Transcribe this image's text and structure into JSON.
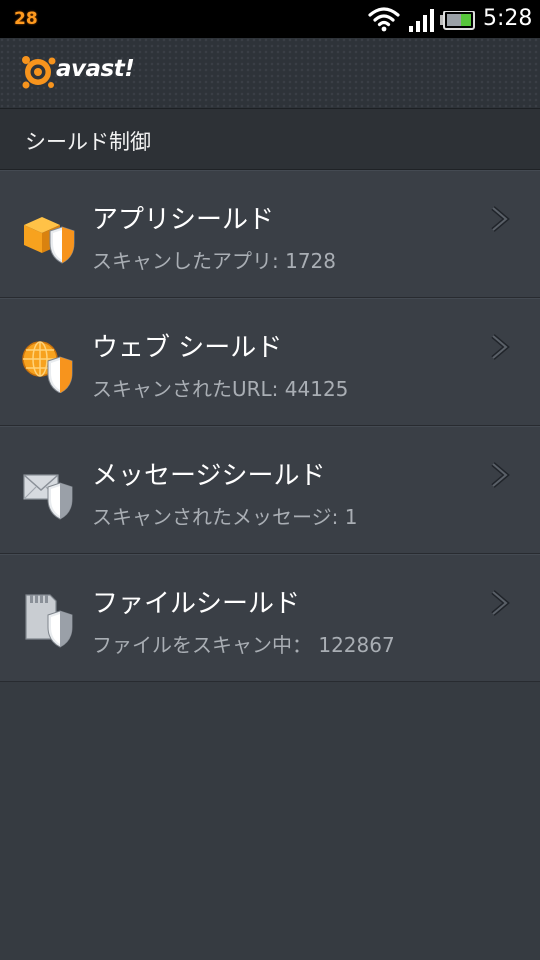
{
  "status_bar": {
    "notification_count": "28",
    "time": "5:28",
    "icons": [
      "wifi-icon",
      "signal-icon",
      "battery-icon"
    ]
  },
  "app_header": {
    "logo_text": "avast!",
    "logo_icon": "avast-logo-icon",
    "brand_color": "#f7941d"
  },
  "section": {
    "title": "シールド制御"
  },
  "shields": [
    {
      "title": "アプリシールド",
      "subtitle": "スキャンしたアプリ: 1728",
      "icon": "app-shield-icon"
    },
    {
      "title": "ウェブ シールド",
      "subtitle": "スキャンされたURL: 44125",
      "icon": "web-shield-icon"
    },
    {
      "title": "メッセージシールド",
      "subtitle": "スキャンされたメッセージ: 1",
      "icon": "message-shield-icon"
    },
    {
      "title": "ファイルシールド",
      "subtitle": "ファイルをスキャン中： 122867",
      "icon": "file-shield-icon"
    }
  ],
  "colors": {
    "background": "#363b41",
    "row": "#3a3f46",
    "subtitle": "#a9aeb4",
    "accent": "#f7941d"
  }
}
